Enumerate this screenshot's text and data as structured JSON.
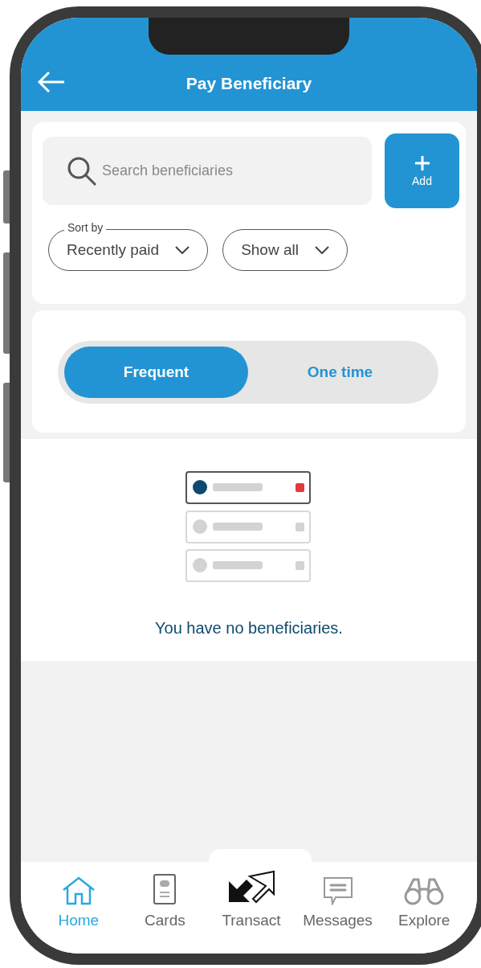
{
  "header": {
    "title": "Pay Beneficiary"
  },
  "search": {
    "placeholder": "Search beneficiaries"
  },
  "add_button": {
    "label": "Add"
  },
  "filters": [
    {
      "label": "Sort by",
      "value": "Recently paid"
    },
    {
      "value": "Show all"
    }
  ],
  "segments": [
    {
      "label": "Frequent",
      "selected": true
    },
    {
      "label": "One time",
      "selected": false
    }
  ],
  "empty_state": {
    "message": "You have no beneficiaries."
  },
  "nav": [
    {
      "label": "Home",
      "kind": "home",
      "selected": true
    },
    {
      "label": "Cards",
      "kind": "cards",
      "selected": false
    },
    {
      "label": "Transact",
      "kind": "transact",
      "selected": false
    },
    {
      "label": "Messages",
      "kind": "messages",
      "selected": false
    },
    {
      "label": "Explore",
      "kind": "explore",
      "selected": false
    }
  ]
}
